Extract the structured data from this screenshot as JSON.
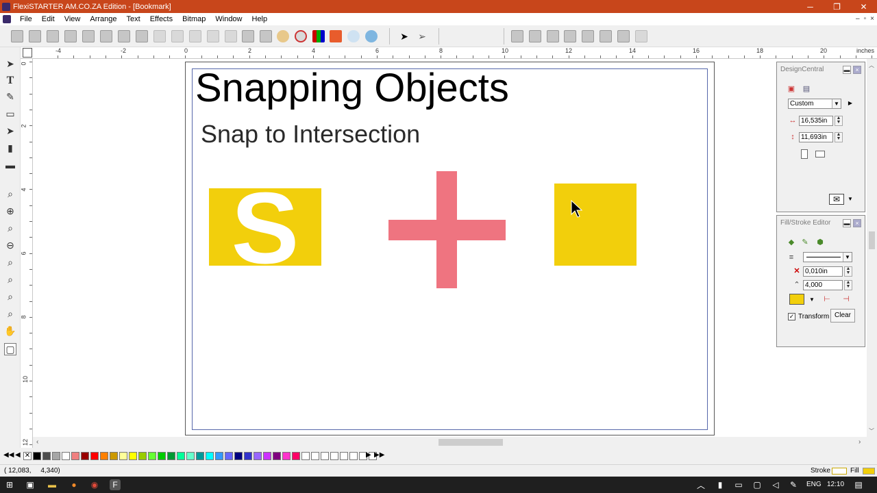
{
  "window": {
    "title": "FlexiSTARTER AM.CO.ZA Edition - [Bookmark]",
    "controls": {
      "minimize": "─",
      "maximize": "❐",
      "close": "✕"
    }
  },
  "menu": {
    "items": [
      "File",
      "Edit",
      "View",
      "Arrange",
      "Text",
      "Effects",
      "Bitmap",
      "Window",
      "Help"
    ],
    "mdi": {
      "minimize": "–",
      "restore": "▫",
      "close": "×"
    }
  },
  "ruler": {
    "h_labels": [
      "-4",
      "-2",
      "0",
      "2",
      "4",
      "6",
      "8",
      "10",
      "12",
      "14",
      "16",
      "18",
      "20"
    ],
    "units": "inches",
    "v_labels": [
      "0",
      "2",
      "4",
      "6",
      "8",
      "10",
      "12"
    ]
  },
  "document": {
    "heading": "Snapping Objects",
    "subheading": "Snap to Intersection",
    "s_letter": "S",
    "colors": {
      "yellow": "#f2cf0c",
      "pink": "#ef7480"
    }
  },
  "design_central": {
    "title": "DesignCentral",
    "preset": "Custom",
    "width": "16,535in",
    "height": "11,693in"
  },
  "fill_stroke": {
    "title": "Fill/Stroke Editor",
    "stroke_width": "0,010in",
    "miter": "4,000",
    "transform_label": "Transform",
    "clear_label": "Clear",
    "fill_color": "#f2cf0c"
  },
  "palette": {
    "colors": [
      "#000000",
      "#4d4d4d",
      "#a6a6a6",
      "#ffffff",
      "#f08080",
      "#990000",
      "#ff0000",
      "#ff8000",
      "#cc9900",
      "#ffff99",
      "#ffff00",
      "#99cc00",
      "#66ff33",
      "#00cc00",
      "#009933",
      "#00ff99",
      "#66ffcc",
      "#009999",
      "#00ffff",
      "#3399ff",
      "#6666ff",
      "#000080",
      "#3333cc",
      "#9966ff",
      "#cc33ff",
      "#800080",
      "#ff33cc",
      "#ff0066"
    ]
  },
  "status": {
    "coords": "( 12,083,     4,340)",
    "stroke_label": "Stroke",
    "fill_label": "Fill",
    "stroke_color": "#ffffff",
    "fill_color": "#f2cf0c"
  },
  "taskbar": {
    "lang": "ENG",
    "time": "12:10"
  }
}
